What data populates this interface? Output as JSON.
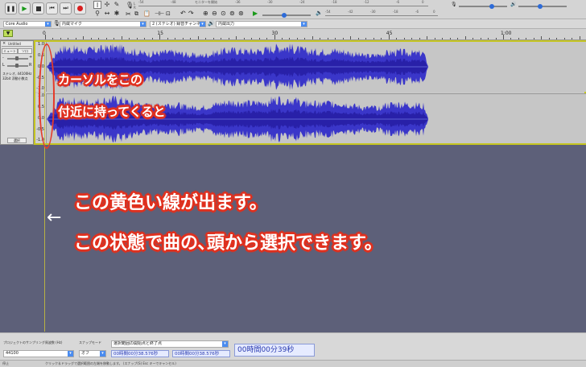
{
  "toolbar": {
    "monitor_label": "モニターを開始",
    "meter_rec_scale": [
      "-54",
      "-48",
      "-42",
      "-36",
      "-30",
      "-24",
      "-18",
      "-12",
      "-6",
      "0"
    ],
    "meter_play_scale": [
      "-54",
      "-48",
      "-42",
      "-36",
      "-30",
      "-24",
      "-18",
      "-12",
      "-6",
      "0"
    ],
    "rec_level": 0.7,
    "play_level": 0.45
  },
  "devices": {
    "host": "Core Audio",
    "input": "内蔵マイク",
    "channels": "2 (ステレオ) 録音チャンネル",
    "output": "内蔵出力"
  },
  "ruler": {
    "labels": [
      "0",
      "15",
      "30",
      "45",
      "1:00"
    ],
    "track_end_seconds": 50,
    "ruler_max_seconds": 75
  },
  "track": {
    "name": "Untitled",
    "mute_label": "ミュート",
    "solo_label": "ソロ",
    "gain_min": "-",
    "gain_max": "+",
    "pan_left": "L",
    "pan_right": "R",
    "info_line1": "ステレオ, 44100Hz",
    "info_line2": "32bit 浮動小数点",
    "select_label": "選択",
    "vruler_top": [
      "1.0",
      "0.5",
      "0.0",
      "-0.5",
      "-1.0"
    ],
    "vruler_bottom": [
      "1.0",
      "0.5",
      "0.0",
      "-0.5",
      "-1.0"
    ]
  },
  "annotations": {
    "cursor_line1": "カーソルをこの",
    "cursor_line2": "付近に持ってくると",
    "yellow_line": "この黄色い線が出ます。",
    "select_from_start": "この状態で曲の､頭から選択できます。",
    "arrow": "←"
  },
  "selection_bar": {
    "rate_label": "プロジェクトのサンプリング周波数 (Hz)",
    "rate_value": "44100",
    "snap_label": "スナップモード",
    "snap_value": "オフ",
    "range_label": "選択範囲の開始点と終了点",
    "start_time": "00時間00分38.576秒",
    "end_time": "00時間00分38.576秒",
    "audio_position": "00時間00分39秒"
  },
  "status": {
    "left": "停止",
    "hint": "クリック＆ドラッグで選択範囲の左端を移動します。 (スナップ(S) Esc キーでキャンセル)"
  },
  "colors": {
    "waveform": "#3a36c9",
    "waveform_dark": "#2820a8",
    "annotation_red": "#e0301e",
    "yellow_line": "#c9c13a",
    "empty_area": "#5d6079"
  }
}
